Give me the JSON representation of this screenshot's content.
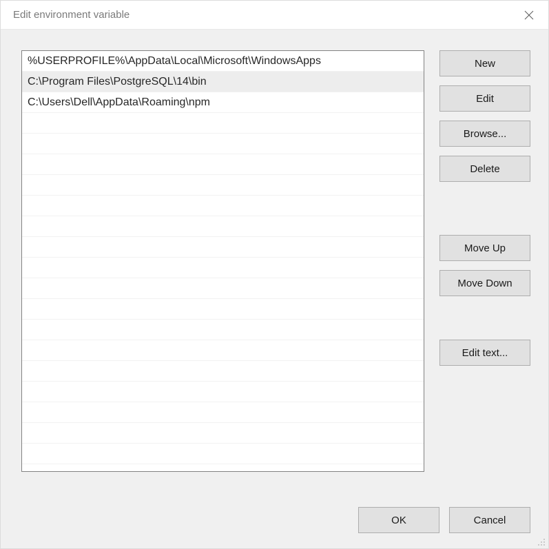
{
  "title": "Edit environment variable",
  "entries": [
    "%USERPROFILE%\\AppData\\Local\\Microsoft\\WindowsApps",
    "C:\\Program Files\\PostgreSQL\\14\\bin",
    "C:\\Users\\Dell\\AppData\\Roaming\\npm"
  ],
  "selectedIndex": 1,
  "buttons": {
    "new": "New",
    "edit": "Edit",
    "browse": "Browse...",
    "delete": "Delete",
    "moveUp": "Move Up",
    "moveDown": "Move Down",
    "editText": "Edit text...",
    "ok": "OK",
    "cancel": "Cancel"
  }
}
